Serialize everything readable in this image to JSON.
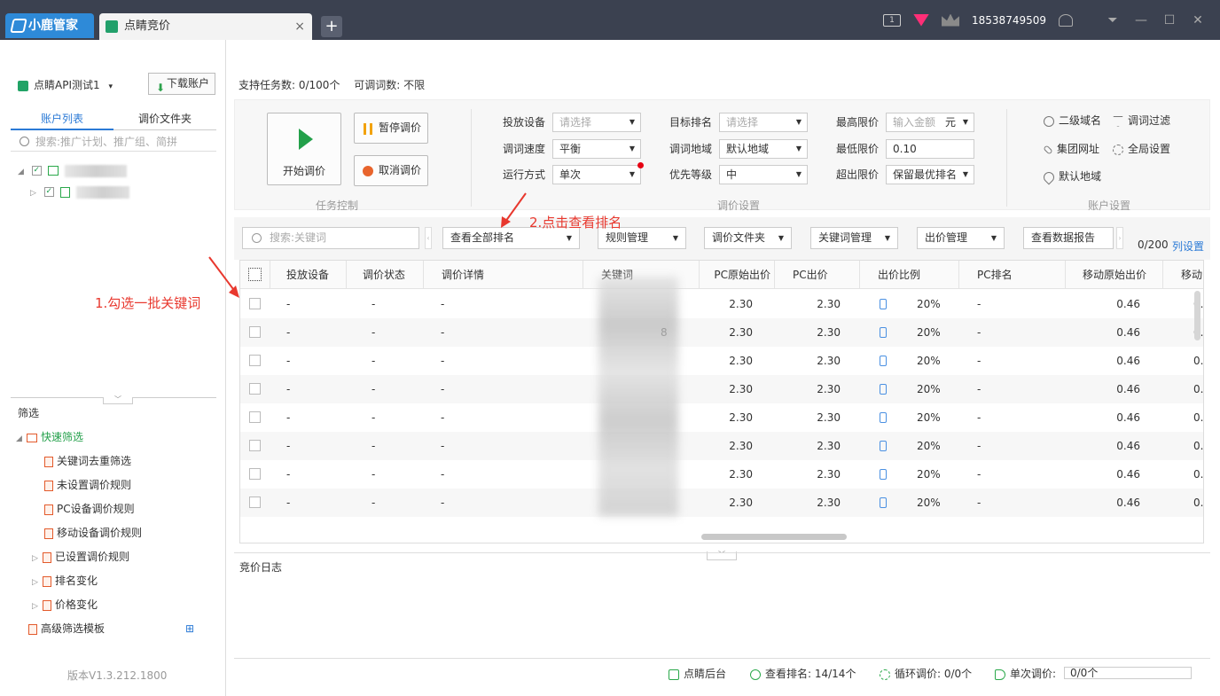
{
  "titlebar": {
    "brand": "小鹿管家",
    "tab_title": "点睛竞价",
    "close": "×",
    "add": "+",
    "screen_badge": "1",
    "phone": "18538749509"
  },
  "left": {
    "account": "点睛API测试1",
    "account_arrow": "▾",
    "download_btn": "下载账户",
    "tabs": [
      "账户列表",
      "调价文件夹"
    ],
    "search_placeholder": "搜索:推广计划、推广组、简拼",
    "filter_title": "筛选",
    "filters": {
      "quick": "快速筛选",
      "quick_items": [
        "关键词去重筛选",
        "未设置调价规则",
        "PC设备调价规则",
        "移动设备调价规则"
      ],
      "groups": [
        "已设置调价规则",
        "排名变化",
        "价格变化"
      ],
      "advanced": "高级筛选模板"
    },
    "version": "版本V1.3.212.1800"
  },
  "info": {
    "tasks_label": "支持任务数: 0/100个",
    "words_label": "可调词数: 不限"
  },
  "controls": {
    "start": "开始调价",
    "pause": "暂停调价",
    "cancel": "取消调价",
    "sec_task": "任务控制",
    "sec_adjust": "调价设置",
    "sec_account": "账户设置",
    "device_label": "投放设备",
    "device_value": "请选择",
    "speed_label": "调词速度",
    "speed_value": "平衡",
    "mode_label": "运行方式",
    "mode_value": "单次",
    "rank_label": "目标排名",
    "rank_value": "请选择",
    "region_label": "调词地域",
    "region_value": "默认地域",
    "priority_label": "优先等级",
    "priority_value": "中",
    "max_label": "最高限价",
    "max_placeholder": "输入金额",
    "max_unit": "元",
    "min_label": "最低限价",
    "min_value": "0.10",
    "over_label": "超出限价",
    "over_value": "保留最优排名",
    "acct_links": [
      "二级域名",
      "调词过滤",
      "集团网址",
      "全局设置",
      "默认地域"
    ]
  },
  "toolbar": {
    "search_placeholder": "搜索:关键词",
    "rank_btn": "查看全部排名",
    "rule_btn": "规则管理",
    "folder_btn": "调价文件夹",
    "kw_btn": "关键词管理",
    "bid_btn": "出价管理",
    "report_btn": "查看数据报告",
    "count": "0/200",
    "col_settings": "列设置"
  },
  "table": {
    "headers": [
      "投放设备",
      "调价状态",
      "调价详情",
      "关键词",
      "PC原始出价",
      "PC出价",
      "出价比例",
      "PC排名",
      "移动原始出价",
      "移动出"
    ],
    "rows": [
      {
        "device": "-",
        "status": "-",
        "detail": "-",
        "kw_tail": "",
        "pc_orig": "2.30",
        "pc_bid": "2.30",
        "ratio": "20%",
        "pc_rank": "-",
        "m_orig": "0.46",
        "m_bid": "0."
      },
      {
        "device": "-",
        "status": "-",
        "detail": "-",
        "kw_tail": "8",
        "pc_orig": "2.30",
        "pc_bid": "2.30",
        "ratio": "20%",
        "pc_rank": "-",
        "m_orig": "0.46",
        "m_bid": "0."
      },
      {
        "device": "-",
        "status": "-",
        "detail": "-",
        "kw_tail": "",
        "pc_orig": "2.30",
        "pc_bid": "2.30",
        "ratio": "20%",
        "pc_rank": "-",
        "m_orig": "0.46",
        "m_bid": "0."
      },
      {
        "device": "-",
        "status": "-",
        "detail": "-",
        "kw_tail": "",
        "pc_orig": "2.30",
        "pc_bid": "2.30",
        "ratio": "20%",
        "pc_rank": "-",
        "m_orig": "0.46",
        "m_bid": "0."
      },
      {
        "device": "-",
        "status": "-",
        "detail": "-",
        "kw_tail": "",
        "pc_orig": "2.30",
        "pc_bid": "2.30",
        "ratio": "20%",
        "pc_rank": "-",
        "m_orig": "0.46",
        "m_bid": "0."
      },
      {
        "device": "-",
        "status": "-",
        "detail": "-",
        "kw_tail": "",
        "pc_orig": "2.30",
        "pc_bid": "2.30",
        "ratio": "20%",
        "pc_rank": "-",
        "m_orig": "0.46",
        "m_bid": "0."
      },
      {
        "device": "-",
        "status": "-",
        "detail": "-",
        "kw_tail": "",
        "pc_orig": "2.30",
        "pc_bid": "2.30",
        "ratio": "20%",
        "pc_rank": "-",
        "m_orig": "0.46",
        "m_bid": "0."
      },
      {
        "device": "-",
        "status": "-",
        "detail": "-",
        "kw_tail": "",
        "pc_orig": "2.30",
        "pc_bid": "2.30",
        "ratio": "20%",
        "pc_rank": "-",
        "m_orig": "0.46",
        "m_bid": "0."
      }
    ]
  },
  "log": {
    "title": "竞价日志"
  },
  "status": {
    "backend": "点睛后台",
    "rank": "查看排名: 14/14个",
    "loop": "循环调价: 0/0个",
    "single_label": "单次调价:",
    "single_value": "0/0个"
  },
  "annotations": {
    "step1": "1.勾选一批关键词",
    "step2": "2.点击查看排名"
  },
  "colors": {
    "accent": "#2b7ad6",
    "green": "#23a04a",
    "annotation": "#e8382e"
  }
}
